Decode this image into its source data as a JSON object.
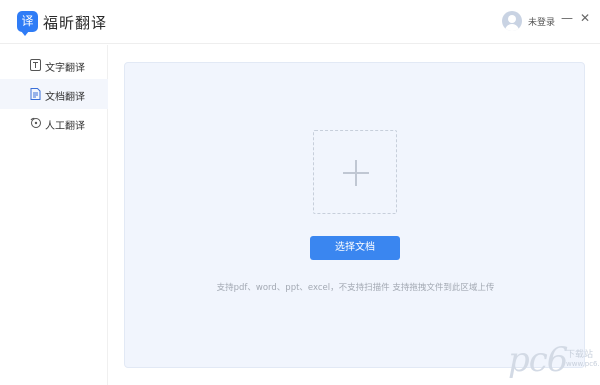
{
  "app": {
    "logo_glyph": "译",
    "title": "福昕翻译",
    "user_label": "未登录",
    "minimize_glyph": "—",
    "close_glyph": "✕"
  },
  "sidebar": {
    "items": [
      {
        "label": "文字翻译",
        "icon": "text-icon"
      },
      {
        "label": "文档翻译",
        "icon": "document-icon",
        "active": true
      },
      {
        "label": "人工翻译",
        "icon": "human-translation-icon"
      }
    ]
  },
  "main": {
    "upload_plus_icon": "plus-icon",
    "choose_button": "选择文档",
    "hint": "支持pdf、word、ppt、excel，不支持扫描件 支持拖拽文件到此区域上传"
  },
  "watermark": {
    "brand": "pc6",
    "line1": "下载站",
    "line2": "www.pc6.com"
  },
  "colors": {
    "accent": "#3a86f0",
    "logo": "#2f7cf6",
    "drop_area_bg": "#f1f5fd",
    "active_side_bg": "#f3f6fc"
  }
}
